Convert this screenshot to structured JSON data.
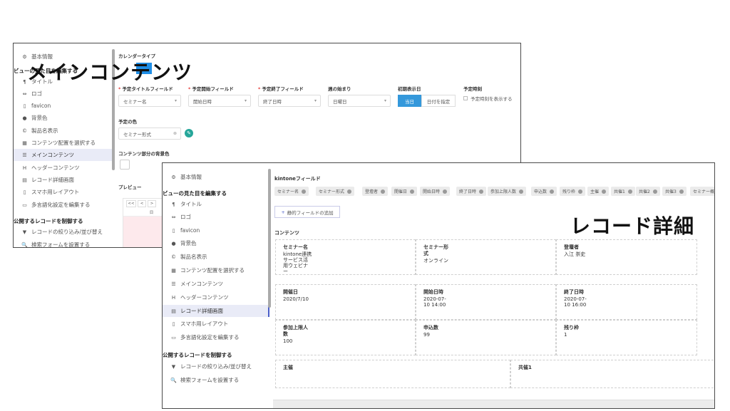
{
  "calendar_window": {
    "sidebar": {
      "items": [
        {
          "icon": "gear-icon",
          "glyph": "⚙",
          "label": "基本情報"
        },
        {
          "icon": "pilcrow-icon",
          "glyph": "¶",
          "label": "タイトル"
        },
        {
          "icon": "link-icon",
          "glyph": "⇔",
          "label": "ロゴ"
        },
        {
          "icon": "bookmark-icon",
          "glyph": "▯",
          "label": "favicon"
        },
        {
          "icon": "drop-icon",
          "glyph": "●",
          "label": "背景色"
        },
        {
          "icon": "copyright-icon",
          "glyph": "©",
          "label": "製品名表示"
        },
        {
          "icon": "grid-icon",
          "glyph": "▦",
          "label": "コンテンツ配置を選択する"
        },
        {
          "icon": "list-icon",
          "glyph": "☰",
          "label": "メインコンテンツ"
        },
        {
          "icon": "heading-icon",
          "glyph": "H",
          "label": "ヘッダーコンテンツ"
        },
        {
          "icon": "table-icon",
          "glyph": "▤",
          "label": "レコード詳細画面"
        },
        {
          "icon": "mobile-icon",
          "glyph": "▯",
          "label": "スマホ用レイアウト"
        },
        {
          "icon": "translate-icon",
          "glyph": "▭",
          "label": "多言語化設定を編集する"
        },
        {
          "icon": "filter-icon",
          "glyph": "▼",
          "label": "レコードの絞り込み/並び替え"
        },
        {
          "icon": "search-icon",
          "glyph": "🔍",
          "label": "検索フォームを設置する"
        }
      ],
      "section_view": "ビューの見た目を編集する",
      "section_publish": "公開するレコードを制御する"
    },
    "calendar_type_label": "カレンダータイプ",
    "fields": {
      "title_label": "予定タイトルフィールド",
      "title_value": "セミナー名",
      "start_label": "予定開始フィールド",
      "start_value": "開始日時",
      "end_label": "予定終了フィールド",
      "end_value": "終了日時",
      "week_label": "週の始まり",
      "week_value": "日曜日",
      "initial_label": "初期表示日",
      "today_button": "当日",
      "date_button": "日付を指定",
      "time_label": "予定時刻",
      "time_checkbox": "予定時刻を表示する"
    },
    "color_label": "予定の色",
    "color_value": "セミナー形式",
    "bg_label": "コンテンツ部分の背景色",
    "preview_label": "プレビュー",
    "nav_buttons": [
      "<<",
      "<",
      ">"
    ],
    "day_header": "日"
  },
  "record_window": {
    "sidebar": {
      "items": [
        {
          "icon": "gear-icon",
          "glyph": "⚙",
          "label": "基本情報"
        },
        {
          "icon": "pilcrow-icon",
          "glyph": "¶",
          "label": "タイトル"
        },
        {
          "icon": "link-icon",
          "glyph": "⇔",
          "label": "ロゴ"
        },
        {
          "icon": "bookmark-icon",
          "glyph": "▯",
          "label": "favicon"
        },
        {
          "icon": "drop-icon",
          "glyph": "●",
          "label": "背景色"
        },
        {
          "icon": "copyright-icon",
          "glyph": "©",
          "label": "製品名表示"
        },
        {
          "icon": "grid-icon",
          "glyph": "▦",
          "label": "コンテンツ配置を選択する"
        },
        {
          "icon": "list-icon",
          "glyph": "☰",
          "label": "メインコンテンツ"
        },
        {
          "icon": "heading-icon",
          "glyph": "H",
          "label": "ヘッダーコンテンツ"
        },
        {
          "icon": "table-icon",
          "glyph": "▤",
          "label": "レコード詳細画面"
        },
        {
          "icon": "mobile-icon",
          "glyph": "▯",
          "label": "スマホ用レイアウト"
        },
        {
          "icon": "translate-icon",
          "glyph": "▭",
          "label": "多言語化設定を編集する"
        },
        {
          "icon": "filter-icon",
          "glyph": "▼",
          "label": "レコードの絞り込み/並び替え"
        },
        {
          "icon": "search-icon",
          "glyph": "🔍",
          "label": "検索フォームを設置する"
        }
      ],
      "section_view": "ビューの見た目を編集する",
      "section_publish": "公開するレコードを制御する"
    },
    "kintone_label": "kintoneフィールド",
    "chips": [
      "セミナー名",
      "セミナー形式",
      "登壇者",
      "開催日",
      "開始日時",
      "終了日時",
      "参加上限人数",
      "申込数",
      "残り枠",
      "主催",
      "共催1",
      "共催2",
      "共催3",
      "セミナー概要"
    ],
    "add_static_button": "静的フィールドの追加",
    "content_label": "コンテンツ",
    "cells": [
      {
        "title": "セミナー名",
        "value": "kintone連携\nサービス活\n用ウェビナ\nー"
      },
      {
        "title": "セミナー形\n式",
        "value": "オンライン"
      },
      {
        "title": "登壇者",
        "value": "入江 崇史"
      },
      {
        "title": "開催日",
        "value": "2020/7/10"
      },
      {
        "title": "開始日時",
        "value": "2020-07-\n10 14:00"
      },
      {
        "title": "終了日時",
        "value": "2020-07-\n10 16:00"
      },
      {
        "title": "参加上限人\n数",
        "value": "100"
      },
      {
        "title": "申込数",
        "value": "99"
      },
      {
        "title": "残り枠",
        "value": "1"
      },
      {
        "title": "主催",
        "value": ""
      },
      {
        "title": "共催1",
        "value": ""
      }
    ]
  },
  "overlays": {
    "main_content": "メインコンテンツ",
    "record_detail": "レコード詳細"
  },
  "colors": {
    "accent_blue": "#3498db",
    "active_bg": "#e9ebf7",
    "teal": "#26a69a",
    "highlight": "#1f8ee6"
  }
}
